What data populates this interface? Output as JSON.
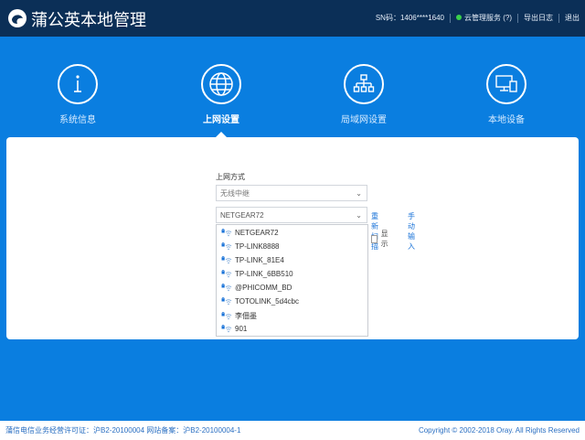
{
  "header": {
    "title": "蒲公英本地管理",
    "sn": "SN码：1406****1640",
    "cloud_service": "云管理服务 (?)",
    "export_log": "导出日志",
    "logout": "退出"
  },
  "nav": {
    "items": [
      {
        "label": "系统信息",
        "icon": "info-icon"
      },
      {
        "label": "上网设置",
        "icon": "globe-icon",
        "active": true
      },
      {
        "label": "局域网设置",
        "icon": "network-icon"
      },
      {
        "label": "本地设备",
        "icon": "devices-icon"
      }
    ]
  },
  "form": {
    "mode_label": "上网方式",
    "mode_value": "无线中继",
    "ssid_value": "NETGEAR72",
    "rescan_label": "重新扫描",
    "manual_label": "手动输入",
    "show_label": "显示"
  },
  "networks": [
    "NETGEAR72",
    "TP-LINK8888",
    "TP-LINK_81E4",
    "TP-LINK_6BB510",
    "@PHICOMM_BD",
    "TOTOLINK_5d4cbc",
    "李佃墨",
    "901"
  ],
  "footer": {
    "license": "蒲信电信业务经营许可证：沪B2-20100004 网站备案：沪B2-20100004-1",
    "copyright": "Copyright © 2002-2018 Oray. All Rights Reserved"
  },
  "colors": {
    "header_bg": "#0b2f57",
    "page_bg": "#0a7ee0",
    "link": "#1a73d8"
  }
}
